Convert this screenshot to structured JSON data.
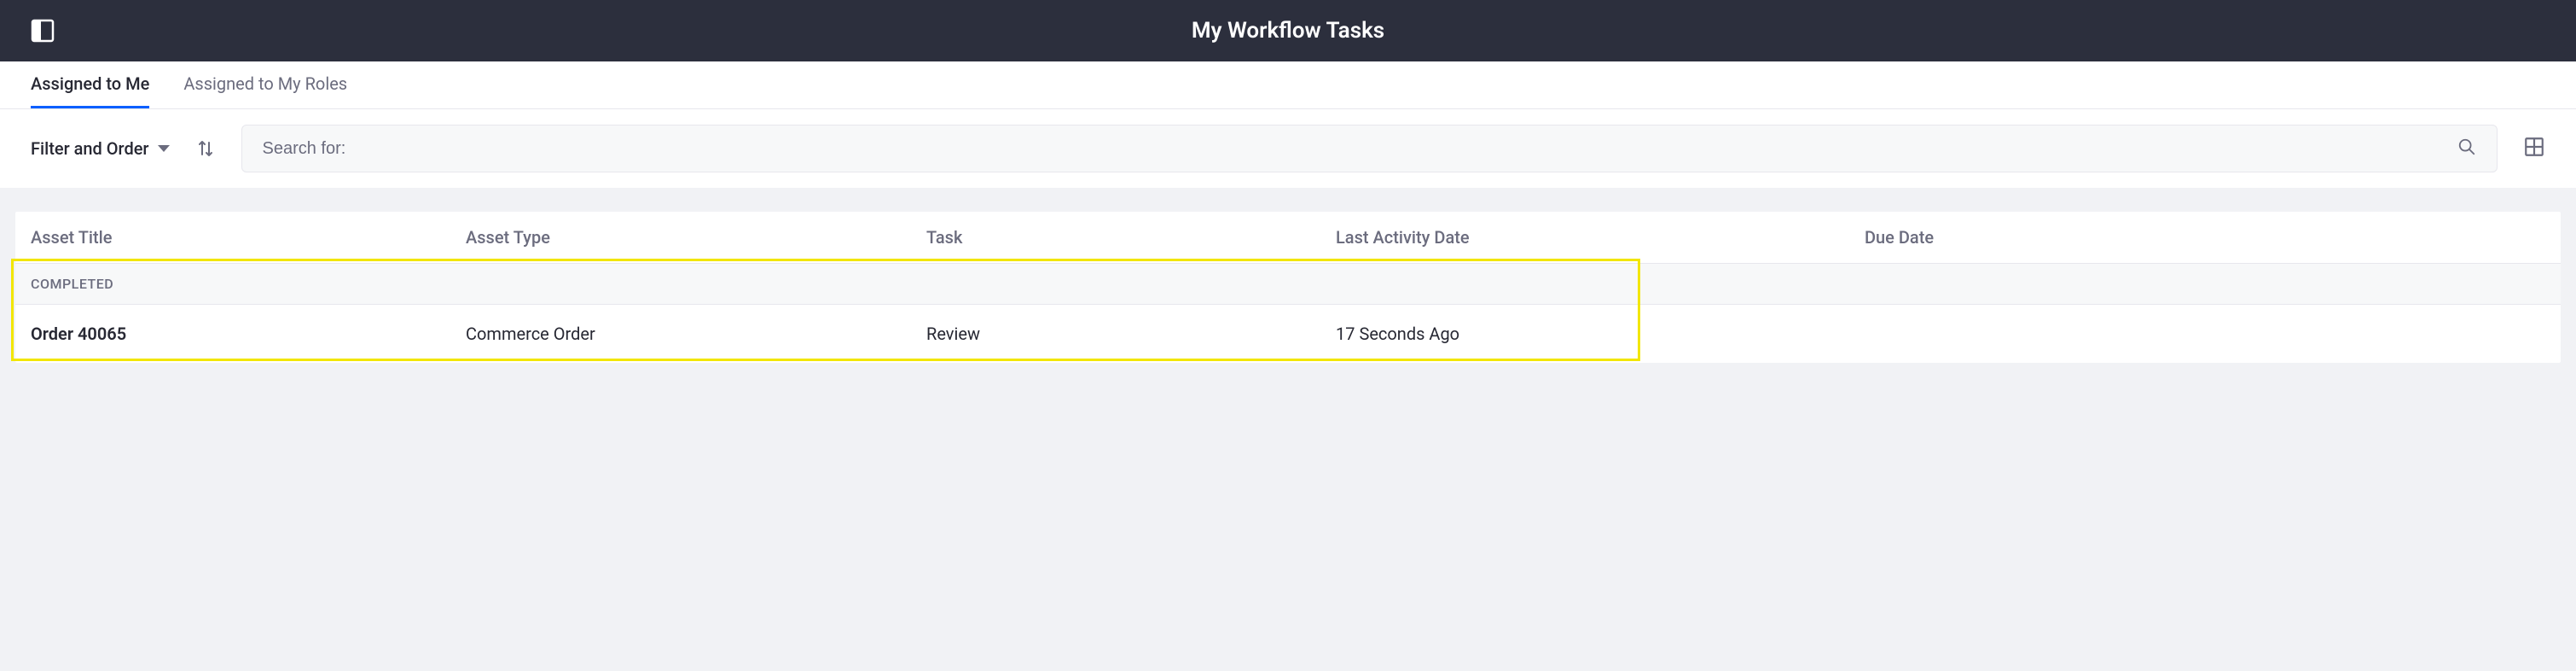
{
  "header": {
    "title": "My Workflow Tasks"
  },
  "tabs": [
    {
      "label": "Assigned to Me",
      "active": true
    },
    {
      "label": "Assigned to My Roles",
      "active": false
    }
  ],
  "toolbar": {
    "filter_label": "Filter and Order",
    "search_placeholder": "Search for:"
  },
  "table": {
    "headers": {
      "asset_title": "Asset Title",
      "asset_type": "Asset Type",
      "task": "Task",
      "last_activity": "Last Activity Date",
      "due_date": "Due Date"
    },
    "group_label": "COMPLETED",
    "rows": [
      {
        "asset_title": "Order 40065",
        "asset_type": "Commerce Order",
        "task": "Review",
        "last_activity": "17 Seconds Ago",
        "due_date": ""
      }
    ]
  }
}
